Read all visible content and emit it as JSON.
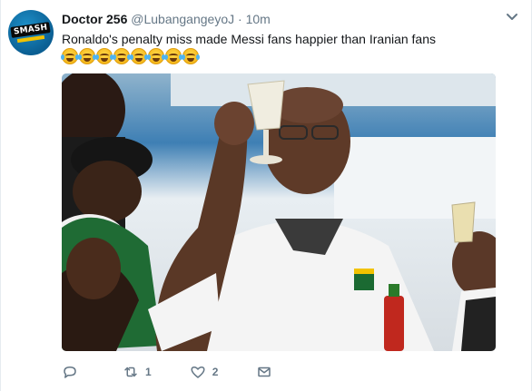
{
  "avatar": {
    "brand_text": "SMASH"
  },
  "header": {
    "name": "Doctor 256",
    "handle": "@LubangangeyoJ",
    "separator": "·",
    "time": "10m"
  },
  "tweet": {
    "text": "Ronaldo's penalty miss made Messi fans happier than Iranian fans",
    "emoji_count": 8,
    "emoji_name": "face-with-tears-of-joy"
  },
  "actions": {
    "reply_count": "",
    "retweet_count": "1",
    "like_count": "2"
  },
  "colors": {
    "text": "#14171a",
    "secondary": "#657786",
    "border": "#e6ecf0"
  }
}
